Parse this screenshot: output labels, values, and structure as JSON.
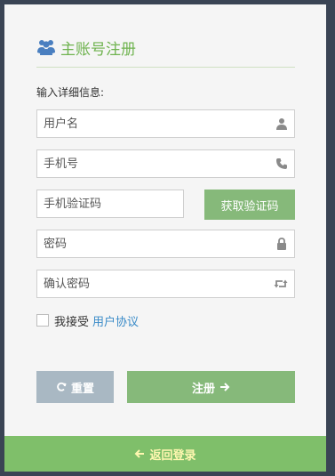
{
  "header": {
    "title": "主账号注册",
    "icon": "users-icon"
  },
  "subtitle": "输入详细信息:",
  "fields": {
    "username": {
      "placeholder": "用户名",
      "value": "",
      "icon": "user-icon"
    },
    "phone": {
      "placeholder": "手机号",
      "value": "",
      "icon": "phone-icon"
    },
    "sms_code": {
      "placeholder": "手机验证码",
      "value": ""
    },
    "password": {
      "placeholder": "密码",
      "value": "",
      "icon": "lock-icon"
    },
    "confirm_password": {
      "placeholder": "确认密码",
      "value": "",
      "icon": "retweet-icon"
    }
  },
  "get_code_button": "获取验证码",
  "agreement": {
    "checked": false,
    "text": "我接受",
    "link": "用户协议"
  },
  "buttons": {
    "reset": "重置",
    "register": "注册"
  },
  "footer": {
    "back_label": "返回登录"
  },
  "colors": {
    "accent_green": "#6fb34f",
    "button_green": "#86b97a",
    "reset_gray": "#a9b8c3",
    "footer_green": "#7fbf6a",
    "footer_text": "#fff7b0",
    "link_blue": "#3a8bc8",
    "background": "#3a4454"
  }
}
